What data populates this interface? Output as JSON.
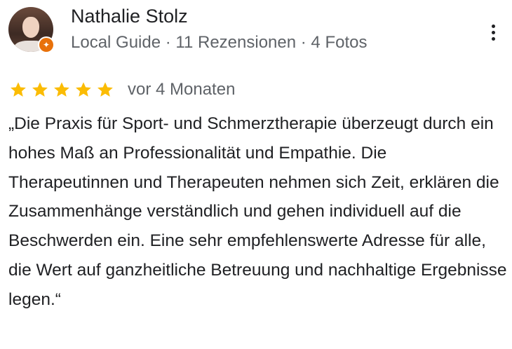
{
  "reviewer": {
    "name": "Nathalie Stolz",
    "meta": "Local Guide · 11 Rezensionen · 4 Fotos"
  },
  "icons": {
    "avatar": "user-avatar-photo",
    "badge": "local-guide-badge-icon",
    "more": "more-vert-icon",
    "star": "star-icon"
  },
  "colors": {
    "star": "#fbbc04",
    "badge": "#e8710a",
    "secondary_text": "#5f6368",
    "primary_text": "#202124"
  },
  "rating": {
    "stars": 5,
    "max": 5,
    "date": "vor 4 Monaten"
  },
  "review_text": "„Die Praxis für Sport- und Schmerztherapie überzeugt durch ein hohes Maß an Professionalität und Empathie. Die Therapeutinnen und Therapeuten nehmen sich Zeit, erklären die Zusammenhänge verständlich und gehen individuell auf die Beschwerden ein. Eine sehr empfehlenswerte Adresse für alle, die Wert auf ganzheitliche Betreuung und nachhaltige Ergebnisse legen.“"
}
